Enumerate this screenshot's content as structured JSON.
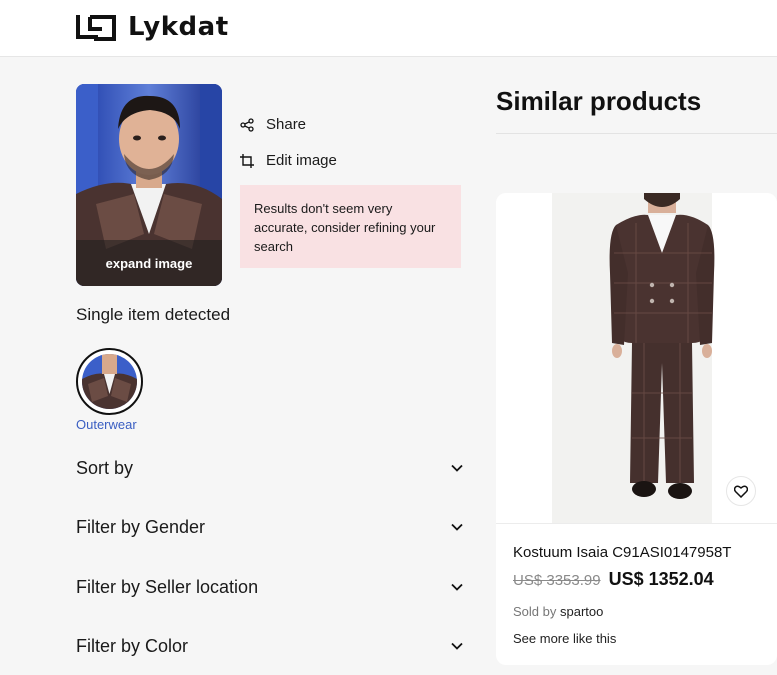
{
  "header": {
    "brand": "Lykdat"
  },
  "query_image": {
    "expand_label": "expand image"
  },
  "actions": {
    "share_label": "Share",
    "edit_label": "Edit image"
  },
  "warning": {
    "text": "Results don't seem very accurate, consider refining your search"
  },
  "detection": {
    "summary": "Single item detected",
    "items": [
      {
        "label": "Outerwear",
        "icon": "outerwear-thumbnail"
      }
    ]
  },
  "filters": [
    {
      "label": "Sort by",
      "icon": "chevron-down-icon"
    },
    {
      "label": "Filter by Gender",
      "icon": "chevron-down-icon"
    },
    {
      "label": "Filter by Seller location",
      "icon": "chevron-down-icon"
    },
    {
      "label": "Filter by Color",
      "icon": "chevron-down-icon"
    }
  ],
  "results": {
    "title": "Similar products",
    "products": [
      {
        "name": "Kostuum Isaia C91ASI0147958T",
        "price_old": "US$ 3353.99",
        "price_new": "US$ 1352.04",
        "sold_by_prefix": "Sold by",
        "seller": "spartoo",
        "see_more_label": "See more like this",
        "favorite_icon": "heart-icon"
      }
    ]
  },
  "colors": {
    "background": "#f6f6f6",
    "warning_bg": "#f9e1e3",
    "link_blue": "#3a5ec2",
    "suit_brown": "#4a3330"
  }
}
